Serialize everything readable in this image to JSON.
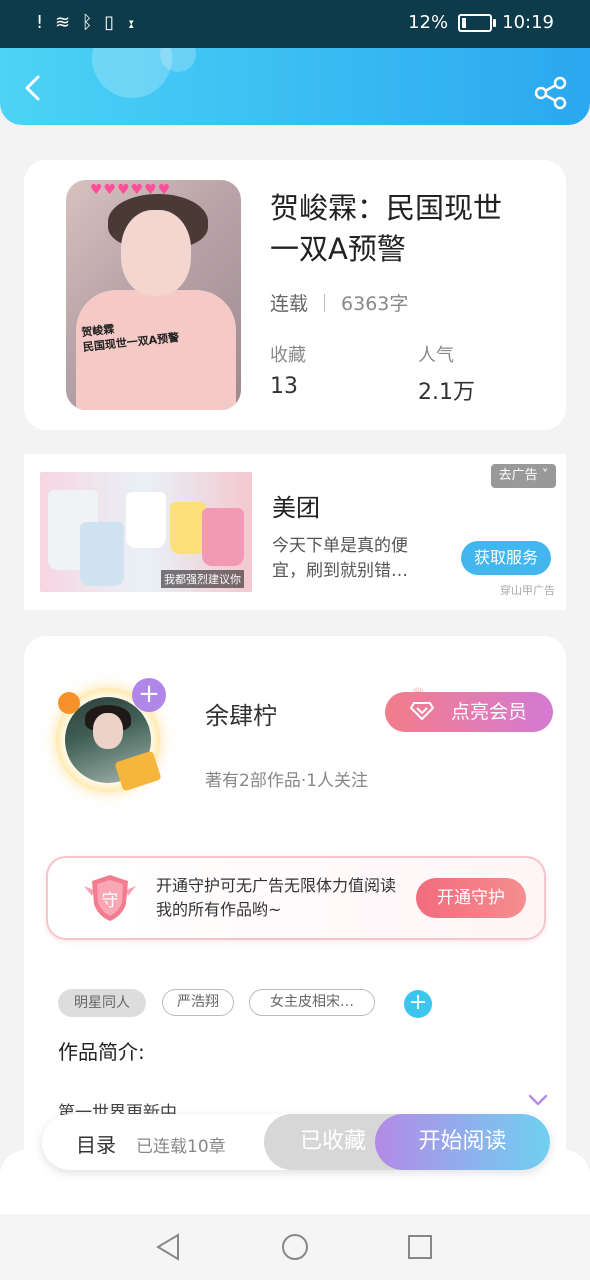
{
  "status": {
    "icons_left": "! ≋ ᛒ ▯ ⧗",
    "battery": "12%",
    "time": "10:19"
  },
  "book": {
    "title": "贺峻霖：民国现世一双A预警",
    "status": "连载",
    "word_count": "6363字",
    "favorites_label": "收藏",
    "favorites_value": "13",
    "popularity_label": "人气",
    "popularity_value": "2.1万",
    "cover_caption": "贺峻霖\n民国现世一双A预警"
  },
  "ad": {
    "title": "美团",
    "desc": "今天下单是真的便宜，刷到就别错…",
    "close_label": "去广告",
    "button": "获取服务",
    "source": "穿山甲广告",
    "image_caption": "我都强烈建议你"
  },
  "author": {
    "name": "余肆柠",
    "info": "著有2部作品·1人关注",
    "vip_button": "点亮会员"
  },
  "guard": {
    "text": "开通守护可无广告无限体力值阅读我的所有作品哟~",
    "button": "开通守护",
    "shield_char": "守"
  },
  "tags": [
    "明星同人",
    "严浩翔",
    "女主皮相宋…"
  ],
  "intro": {
    "label": "作品简介:",
    "text": "第一世界更新中"
  },
  "bottom": {
    "toc": "目录",
    "chapters": "已连载10章",
    "collected": "已收藏",
    "start": "开始阅读"
  },
  "colors": {
    "header_start": "#4cd3f5",
    "header_end": "#2aa8f0",
    "accent_blue": "#43b6f0",
    "vip_pink": "#f27d8a",
    "guard_red": "#f26b7e"
  }
}
